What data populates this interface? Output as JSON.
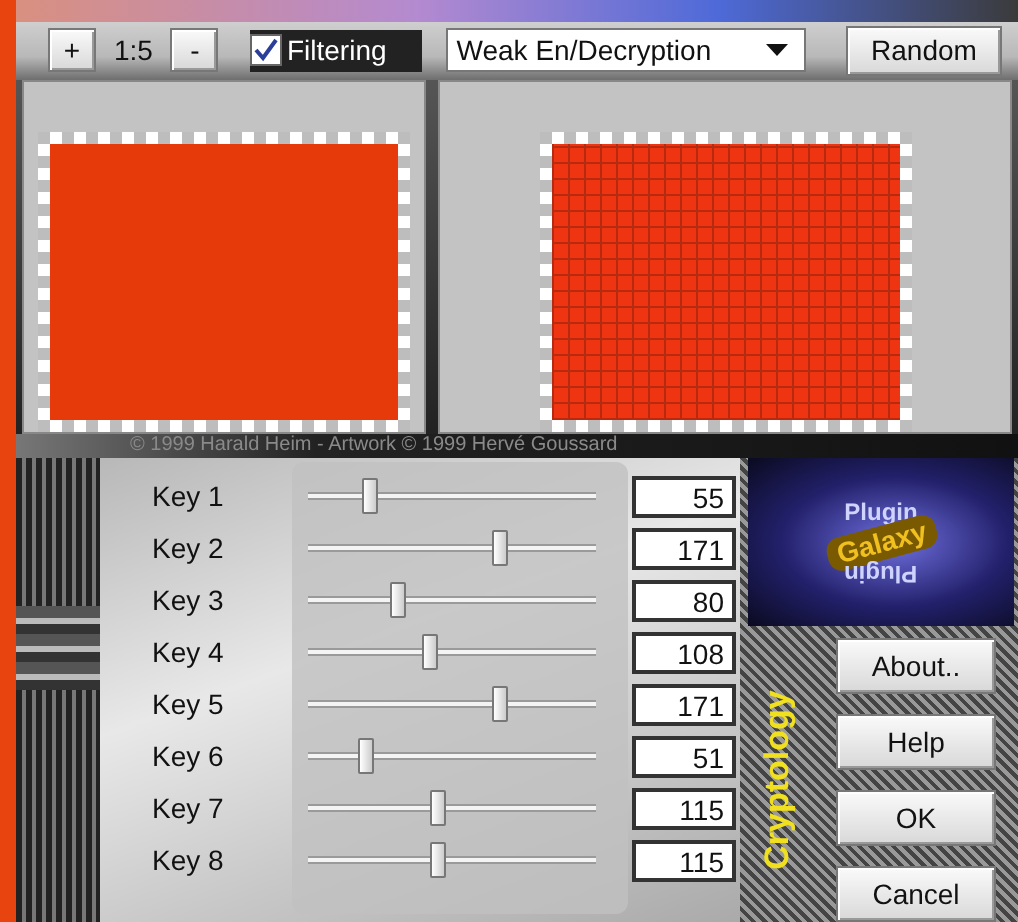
{
  "toolbar": {
    "zoom_in": "+",
    "zoom": "1:5",
    "zoom_out": "-",
    "filtering": {
      "label": "Filtering",
      "checked": true
    },
    "mode": "Weak En/Decryption",
    "random": "Random"
  },
  "previews": [
    {
      "kind": "original"
    },
    {
      "kind": "filtered"
    }
  ],
  "copyright": "© 1999 Harald Heim - Artwork © 1999 Hervé Goussard",
  "keys": [
    {
      "label": "Key 1",
      "level": 0.216,
      "value": "55"
    },
    {
      "label": "Key 2",
      "level": 0.67,
      "value": "171"
    },
    {
      "label": "Key 3",
      "level": 0.314,
      "value": "80"
    },
    {
      "label": "Key 4",
      "level": 0.424,
      "value": "108"
    },
    {
      "label": "Key 5",
      "level": 0.67,
      "value": "171"
    },
    {
      "label": "Key 6",
      "level": 0.2,
      "value": "51"
    },
    {
      "label": "Key 7",
      "level": 0.451,
      "value": "115"
    },
    {
      "label": "Key 8",
      "level": 0.451,
      "value": "115"
    }
  ],
  "logo": {
    "top": "Plugin",
    "middle": "Galaxy",
    "bottom": "Plugin"
  },
  "side_title": "Cryptology",
  "buttons": [
    "About..",
    "Help",
    "OK",
    "Cancel"
  ]
}
